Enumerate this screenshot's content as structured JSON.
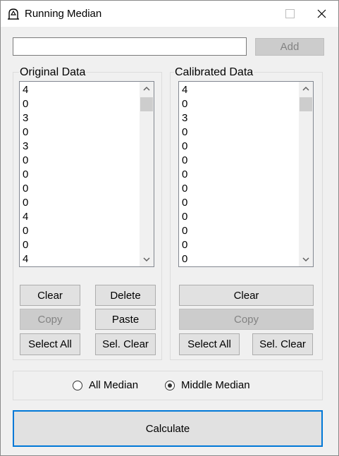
{
  "window": {
    "title": "Running Median"
  },
  "input": {
    "value": "",
    "placeholder": ""
  },
  "add_button": "Add",
  "original": {
    "title": "Original Data",
    "items": [
      "4",
      "0",
      "3",
      "0",
      "3",
      "0",
      "0",
      "0",
      "0",
      "4",
      "0",
      "0",
      "4"
    ],
    "buttons": {
      "clear": "Clear",
      "delete": "Delete",
      "copy": "Copy",
      "paste": "Paste",
      "select_all": "Select All",
      "sel_clear": "Sel. Clear"
    }
  },
  "calibrated": {
    "title": "Calibrated Data",
    "items": [
      "4",
      "0",
      "3",
      "0",
      "0",
      "0",
      "0",
      "0",
      "0",
      "0",
      "0",
      "0",
      "0"
    ],
    "buttons": {
      "clear": "Clear",
      "copy": "Copy",
      "select_all": "Select All",
      "sel_clear": "Sel. Clear"
    }
  },
  "mode": {
    "all_median": "All Median",
    "middle_median": "Middle Median",
    "selected": "middle_median"
  },
  "calculate": "Calculate",
  "colors": {
    "accent": "#0078d7",
    "disabled_text": "#838383"
  }
}
